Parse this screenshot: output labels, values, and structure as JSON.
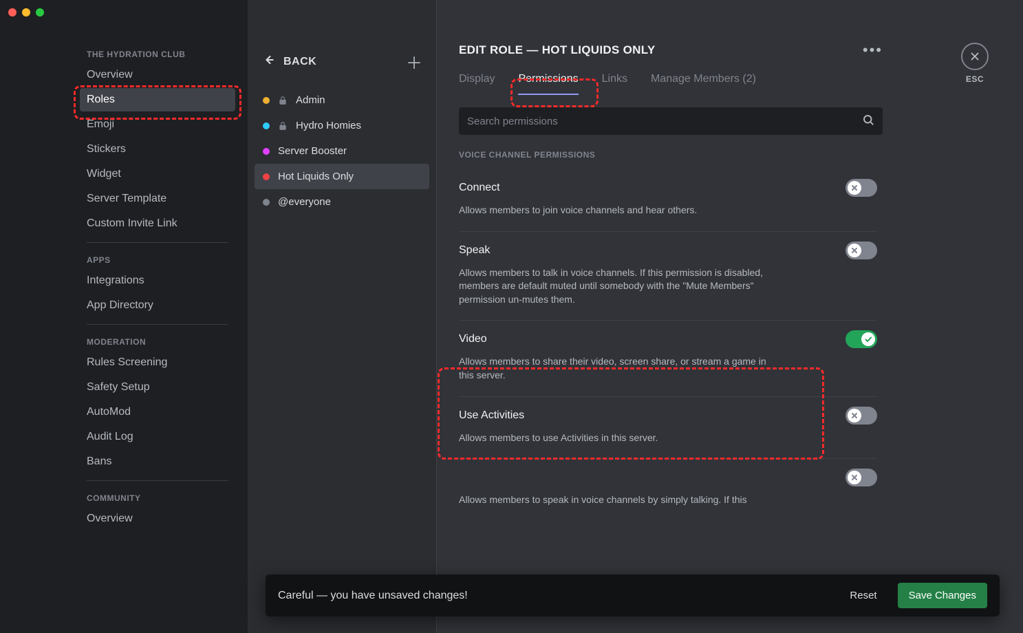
{
  "sidebar": {
    "server_name": "THE HYDRATION CLUB",
    "section_apps": "APPS",
    "section_moderation": "MODERATION",
    "section_community": "COMMUNITY",
    "items_general": [
      {
        "label": "Overview",
        "active": false
      },
      {
        "label": "Roles",
        "active": true
      },
      {
        "label": "Emoji",
        "active": false
      },
      {
        "label": "Stickers",
        "active": false
      },
      {
        "label": "Widget",
        "active": false
      },
      {
        "label": "Server Template",
        "active": false
      },
      {
        "label": "Custom Invite Link",
        "active": false
      }
    ],
    "items_apps": [
      {
        "label": "Integrations"
      },
      {
        "label": "App Directory"
      }
    ],
    "items_moderation": [
      {
        "label": "Rules Screening"
      },
      {
        "label": "Safety Setup"
      },
      {
        "label": "AutoMod"
      },
      {
        "label": "Audit Log"
      },
      {
        "label": "Bans"
      }
    ],
    "items_community": [
      {
        "label": "Overview"
      }
    ]
  },
  "roles_column": {
    "back_label": "BACK",
    "roles": [
      {
        "label": "Admin",
        "color": "#f0b132",
        "locked": true,
        "selected": false
      },
      {
        "label": "Hydro Homies",
        "color": "#2eccfa",
        "locked": true,
        "selected": false
      },
      {
        "label": "Server Booster",
        "color": "#e040fb",
        "locked": false,
        "selected": false
      },
      {
        "label": "Hot Liquids Only",
        "color": "#ed4245",
        "locked": false,
        "selected": true
      },
      {
        "label": "@everyone",
        "color": "#80848e",
        "locked": false,
        "selected": false
      }
    ]
  },
  "main": {
    "title": "EDIT ROLE — HOT LIQUIDS ONLY",
    "esc_label": "ESC",
    "tabs": [
      {
        "label": "Display",
        "active": false
      },
      {
        "label": "Permissions",
        "active": true
      },
      {
        "label": "Links",
        "active": false
      },
      {
        "label": "Manage Members (2)",
        "active": false
      }
    ],
    "search_placeholder": "Search permissions",
    "perm_section_header": "VOICE CHANNEL PERMISSIONS",
    "permissions": [
      {
        "name": "Connect",
        "desc": "Allows members to join voice channels and hear others.",
        "on": false
      },
      {
        "name": "Speak",
        "desc": "Allows members to talk in voice channels. If this permission is disabled, members are default muted until somebody with the \"Mute Members\" permission un-mutes them.",
        "on": false
      },
      {
        "name": "Video",
        "desc": "Allows members to share their video, screen share, or stream a game in this server.",
        "on": true
      },
      {
        "name": "Use Activities",
        "desc": "Allows members to use Activities in this server.",
        "on": false
      },
      {
        "name": "",
        "desc": "Allows members to speak in voice channels by simply talking. If this",
        "on": false
      }
    ]
  },
  "unsaved_bar": {
    "message": "Careful — you have unsaved changes!",
    "reset_label": "Reset",
    "save_label": "Save Changes"
  }
}
